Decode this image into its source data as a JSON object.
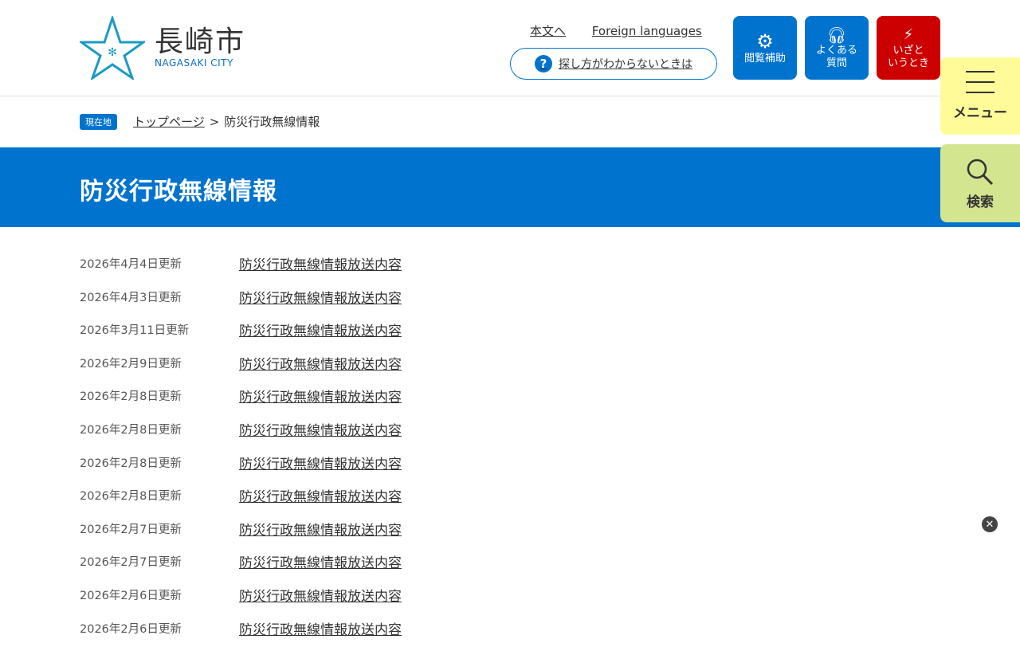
{
  "logo": {
    "title": "長崎市",
    "subtitle": "NAGASAKI CITY"
  },
  "header": {
    "links": [
      "本文へ",
      "Foreign languages"
    ],
    "help": "探し方がわからないときは",
    "buttons": [
      {
        "label1": "閲覧補助",
        "label2": ""
      },
      {
        "label1": "よくある",
        "label2": "質問"
      },
      {
        "label1": "いざと",
        "label2": "いうとき"
      }
    ]
  },
  "side": {
    "menu": "メニュー",
    "search": "検索"
  },
  "breadcrumb": {
    "badge": "現在地",
    "home": "トップページ",
    "sep": ">",
    "current": "防災行政無線情報"
  },
  "page_title": "防災行政無線情報",
  "items": [
    {
      "date": "2026年4月4日更新",
      "title": "防災行政無線情報放送内容"
    },
    {
      "date": "2026年4月3日更新",
      "title": "防災行政無線情報放送内容"
    },
    {
      "date": "2026年3月11日更新",
      "title": "防災行政無線情報放送内容"
    },
    {
      "date": "2026年2月9日更新",
      "title": "防災行政無線情報放送内容"
    },
    {
      "date": "2026年2月8日更新",
      "title": "防災行政無線情報放送内容"
    },
    {
      "date": "2026年2月8日更新",
      "title": "防災行政無線情報放送内容"
    },
    {
      "date": "2026年2月8日更新",
      "title": "防災行政無線情報放送内容"
    },
    {
      "date": "2026年2月8日更新",
      "title": "防災行政無線情報放送内容"
    },
    {
      "date": "2026年2月7日更新",
      "title": "防災行政無線情報放送内容"
    },
    {
      "date": "2026年2月7日更新",
      "title": "防災行政無線情報放送内容"
    },
    {
      "date": "2026年2月6日更新",
      "title": "防災行政無線情報放送内容"
    },
    {
      "date": "2026年2月6日更新",
      "title": "防災行政無線情報放送内容"
    }
  ],
  "colors": {
    "brand": "#0073cf",
    "emergency": "#cc0000",
    "menu": "#fffb99",
    "search": "#d4e590"
  }
}
